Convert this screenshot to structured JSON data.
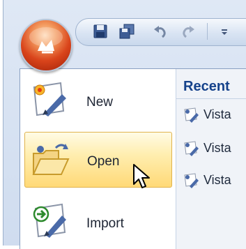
{
  "colors": {
    "accent": "#15428b",
    "highlight": "#ffeeb0",
    "orb": "#d9441b"
  },
  "app_button": {
    "icon": "office-logo-icon"
  },
  "quick_access_toolbar": {
    "items": [
      {
        "icon": "save-icon"
      },
      {
        "icon": "save-all-icon"
      },
      {
        "icon": "undo-icon"
      },
      {
        "icon": "redo-icon"
      }
    ],
    "overflow_icon": "dropdown-icon"
  },
  "menu": {
    "items": [
      {
        "label": "New",
        "icon": "new-document-icon",
        "highlighted": false
      },
      {
        "label": "Open",
        "icon": "open-folder-icon",
        "highlighted": true
      },
      {
        "label": "Import",
        "icon": "import-icon",
        "highlighted": false
      }
    ]
  },
  "recent": {
    "header": "Recent",
    "items": [
      {
        "label": "Vista",
        "icon": "document-icon"
      },
      {
        "label": "Vista",
        "icon": "document-icon"
      },
      {
        "label": "Vista",
        "icon": "document-icon"
      }
    ]
  }
}
